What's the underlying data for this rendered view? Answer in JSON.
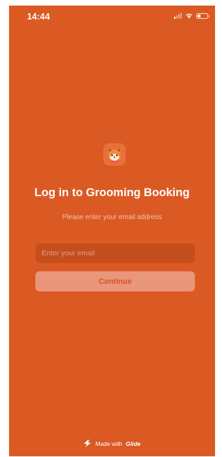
{
  "status_bar": {
    "time": "14:44",
    "battery_level": 0.3
  },
  "app": {
    "icon": "fox-icon"
  },
  "login": {
    "title": "Log in to Grooming Booking",
    "subtitle": "Please enter your email address",
    "email_placeholder": "Enter your email",
    "email_value": "",
    "continue_label": "Continue"
  },
  "footer": {
    "made_with": "Made with",
    "brand": "Glide",
    "icon": "glide-bolt-icon"
  },
  "colors": {
    "background": "#db5a23",
    "input_background": "#c54e1e",
    "button_background": "#e9967a",
    "button_text": "#d9511d"
  }
}
